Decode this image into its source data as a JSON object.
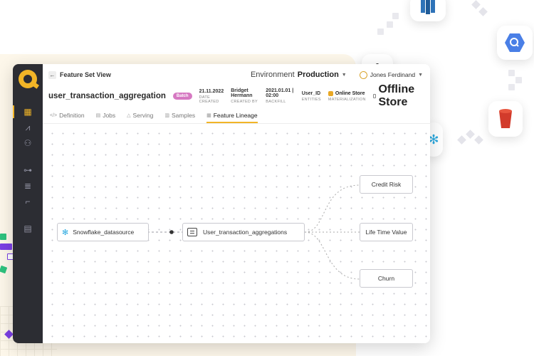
{
  "header": {
    "breadcrumb": "Feature Set View",
    "environment_label": "Environment",
    "environment_value": "Production",
    "user_name": "Jones Ferdinand"
  },
  "feature_set": {
    "name": "user_transaction_aggregation",
    "badge": "Batch",
    "meta": [
      {
        "value": "21.11.2022",
        "key": "DATE CREATED"
      },
      {
        "value": "Bridget Hermann",
        "key": "CREATED BY"
      },
      {
        "value": "2021.01.01 | 02:00",
        "key": "BACKFILL"
      },
      {
        "value": "User_ID",
        "key": "ENTITIES"
      }
    ],
    "online_store": "Online Store",
    "materialization": "MATERIALIZATION",
    "offline_store": "Offline Store"
  },
  "tabs": [
    {
      "label": "Definition",
      "icon": "code-icon"
    },
    {
      "label": "Jobs",
      "icon": "doc-icon"
    },
    {
      "label": "Serving",
      "icon": "triangle-icon"
    },
    {
      "label": "Samples",
      "icon": "chart-icon"
    },
    {
      "label": "Feature Lineage",
      "icon": "lineage-icon",
      "active": true
    }
  ],
  "lineage": {
    "source": "Snowflake_datasource",
    "feature_set": "User_transaction_aggregations",
    "targets": [
      "Credit Risk",
      "Life Time Value",
      "Churn"
    ]
  },
  "colors": {
    "accent": "#f2b527",
    "rail": "#2c2d33",
    "badge": "#d679c2",
    "snowflake": "#2aa9e0"
  }
}
